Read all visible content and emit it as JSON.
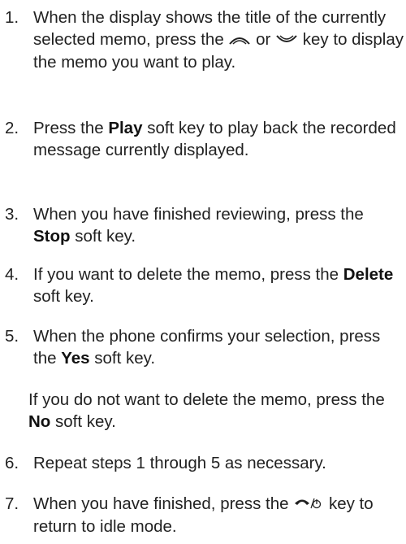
{
  "steps": [
    {
      "number": "1.",
      "text_before": "When the display shows the title of the currently selected memo, press the",
      "icon_up": "up-arrow-key-icon",
      "connector": "or",
      "icon_down": "down-arrow-key-icon",
      "text_after": "key to display the memo you want to play."
    },
    {
      "number": "2.",
      "text_before": "Press the",
      "bold": "Play",
      "text_after": "soft key to play back the recorded message currently displayed."
    },
    {
      "number": "3.",
      "text_before": "When you have finished reviewing, press the",
      "bold": "Stop",
      "text_after": "soft key."
    },
    {
      "number": "4.",
      "text_before": "If you want to delete the memo, press the",
      "bold": "Delete",
      "text_after": "soft key."
    },
    {
      "number": "5.",
      "text_before": "When the phone confirms your selection, press the",
      "bold": "Yes",
      "text_after": "soft key."
    },
    {
      "number": "6.",
      "text": "Repeat steps 1 through 5 as necessary."
    },
    {
      "number": "7.",
      "text_before": "When you have finished, press the",
      "icon_end": "end-power-key-icon",
      "text_after": "key to return to idle mode."
    }
  ],
  "note": {
    "text_before": "If you do not want to delete the memo, press the",
    "bold": "No",
    "text_after": "soft key."
  }
}
